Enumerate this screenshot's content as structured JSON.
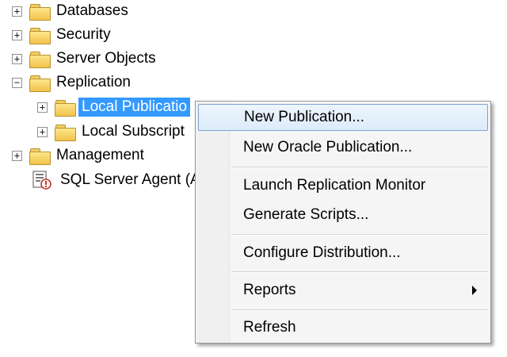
{
  "tree": {
    "items": [
      {
        "label": "Databases",
        "expander": "+"
      },
      {
        "label": "Security",
        "expander": "+"
      },
      {
        "label": "Server Objects",
        "expander": "+"
      },
      {
        "label": "Replication",
        "expander": "−"
      },
      {
        "label": "Local Publicatio",
        "expander": "+"
      },
      {
        "label": "Local Subscript",
        "expander": "+"
      },
      {
        "label": "Management",
        "expander": "+"
      },
      {
        "label": "SQL Server Agent (A"
      }
    ]
  },
  "context_menu": {
    "items": [
      {
        "label": "New Publication..."
      },
      {
        "label": "New Oracle Publication..."
      },
      {
        "label": "Launch Replication Monitor"
      },
      {
        "label": "Generate Scripts..."
      },
      {
        "label": "Configure Distribution..."
      },
      {
        "label": "Reports"
      },
      {
        "label": "Refresh"
      }
    ]
  },
  "colors": {
    "selection": "#3399ff",
    "menu_hover_border": "#7da2ce",
    "folder": "#f1c24a"
  },
  "icons": [
    "expand-icon",
    "collapse-icon",
    "folder-icon",
    "sql-agent-icon",
    "submenu-arrow-icon"
  ]
}
